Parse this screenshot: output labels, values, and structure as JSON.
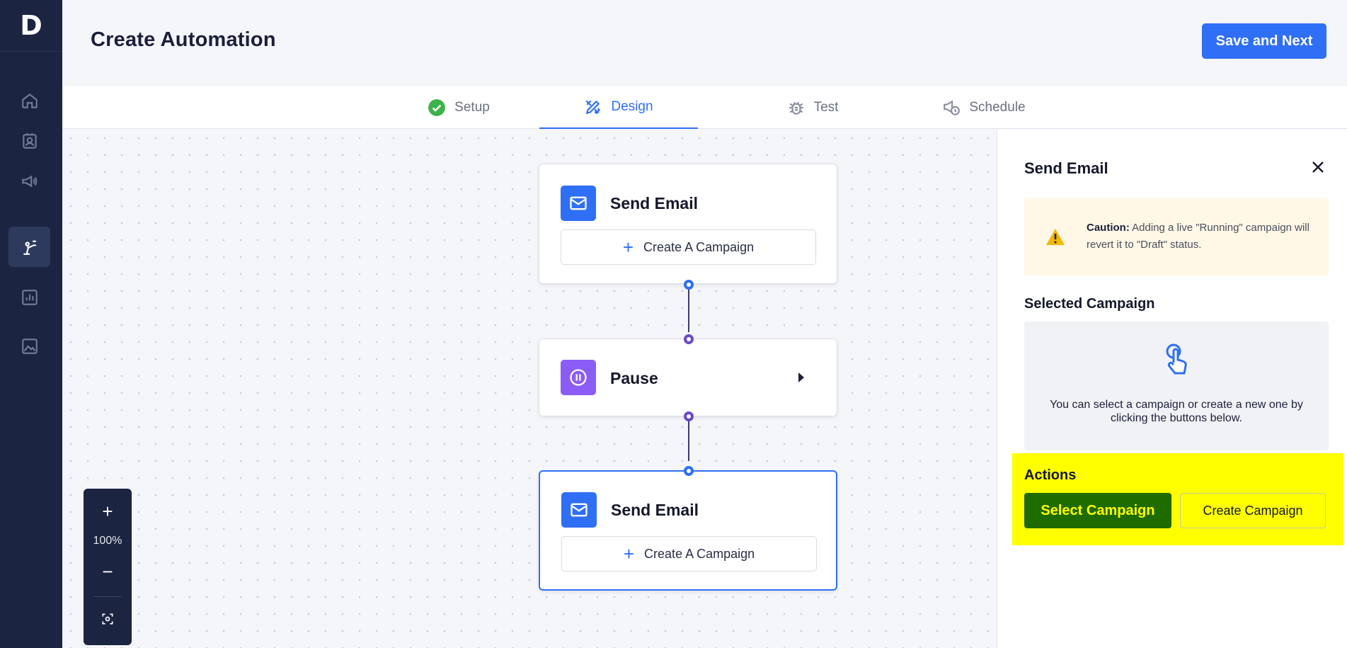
{
  "app": {
    "logo": "D"
  },
  "sidebar": {
    "items": [
      {
        "icon": "home-icon",
        "active": false
      },
      {
        "icon": "contacts-icon",
        "active": false
      },
      {
        "icon": "megaphone-icon",
        "active": false
      },
      {
        "icon": "automation-icon",
        "active": true
      },
      {
        "icon": "reports-icon",
        "active": false
      },
      {
        "icon": "media-icon",
        "active": false
      }
    ]
  },
  "header": {
    "title": "Create Automation",
    "save_label": "Save and Next"
  },
  "tabs": [
    {
      "label": "Setup",
      "icon": "check-circle-icon",
      "active": false
    },
    {
      "label": "Design",
      "icon": "design-tools-icon",
      "active": true
    },
    {
      "label": "Test",
      "icon": "bug-icon",
      "active": false
    },
    {
      "label": "Schedule",
      "icon": "schedule-icon",
      "active": false
    }
  ],
  "canvas": {
    "nodes": [
      {
        "type": "send-email",
        "title": "Send Email",
        "action": "Create A Campaign",
        "selected": false
      },
      {
        "type": "pause",
        "title": "Pause",
        "selected": false
      },
      {
        "type": "send-email",
        "title": "Send Email",
        "action": "Create A Campaign",
        "selected": true
      }
    ],
    "zoom": {
      "level": "100%",
      "plus": "+",
      "minus": "−"
    }
  },
  "panel": {
    "title": "Send Email",
    "caution": {
      "label": "Caution:",
      "text": " Adding a live \"Running\" campaign will revert it to \"Draft\" status."
    },
    "selected_campaign": {
      "title": "Selected Campaign",
      "empty_text": "You can select a campaign or create a new one by clicking the buttons below."
    },
    "actions": {
      "title": "Actions",
      "select_label": "Select Campaign",
      "create_label": "Create Campaign"
    }
  },
  "colors": {
    "accent": "#2f6ff5",
    "sidebar": "#1b2440",
    "highlight": "#ffff00",
    "select_button": "#1e6b00",
    "pause": "#8b5cf6",
    "setup_check": "#3db24b"
  }
}
